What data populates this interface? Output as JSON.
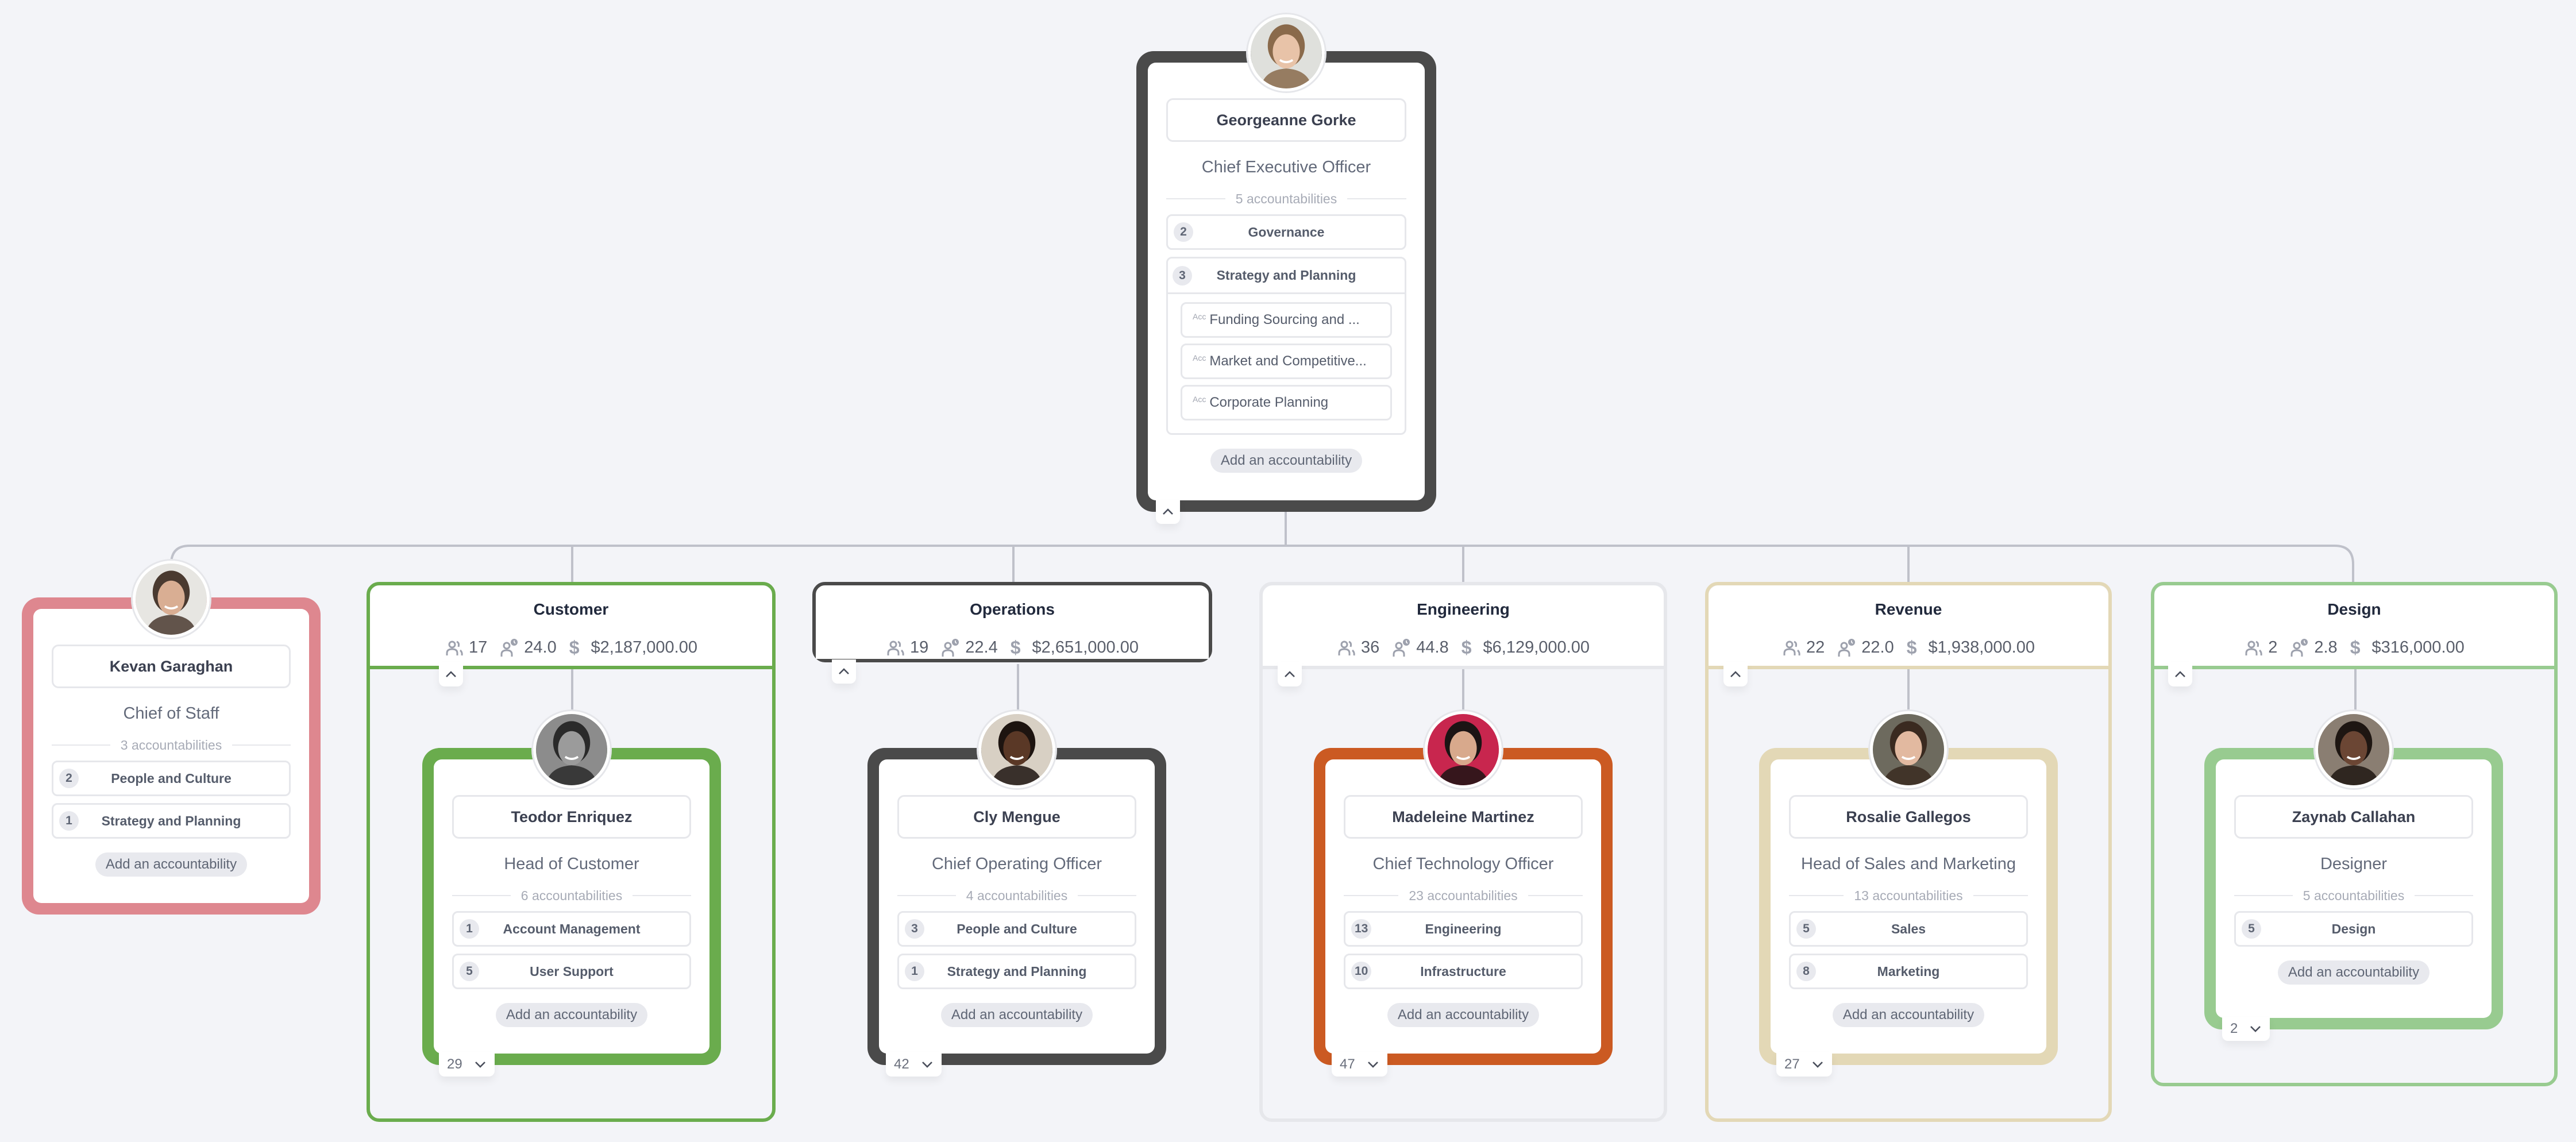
{
  "ceo": {
    "name": "Georgeanne Gorke",
    "role": "Chief Executive Officer",
    "accountabilities_label": "5 accountabilities",
    "border_color": "#4a4a4a",
    "avatar": {
      "skin": "#e8c3a8",
      "hair": "#8a6a4b",
      "bg": "#dfe0dc"
    },
    "accountabilities": [
      {
        "count": "2",
        "label": "Governance"
      }
    ],
    "expanded_group": {
      "count": "3",
      "label": "Strategy and Planning",
      "tag": "Acc",
      "items": [
        "Funding Sourcing and ...",
        "Market and Competitive...",
        "Corporate Planning"
      ]
    },
    "add_label": "Add an accountability"
  },
  "chief_of_staff": {
    "name": "Kevan Garaghan",
    "role": "Chief of Staff",
    "accountabilities_label": "3 accountabilities",
    "border_color": "#de878f",
    "avatar": {
      "skin": "#d9ae93",
      "hair": "#4a3a30",
      "bg": "#e7e6e2"
    },
    "accountabilities": [
      {
        "count": "2",
        "label": "People and Culture"
      },
      {
        "count": "1",
        "label": "Strategy and Planning"
      }
    ],
    "add_label": "Add an accountability"
  },
  "teams": [
    {
      "title": "Customer",
      "headcount": "17",
      "fte": "24.0",
      "budget": "$2,187,000.00",
      "color": "#6aac4d",
      "collapse_label": "^",
      "lead": {
        "name": "Teodor Enriquez",
        "role": "Head of Customer",
        "accountabilities_label": "6 accountabilities",
        "avatar": {
          "skin": "#9b9b9b",
          "hair": "#2a2a2a",
          "bg": "#8c8c8c"
        },
        "accountabilities": [
          {
            "count": "1",
            "label": "Account Management"
          },
          {
            "count": "5",
            "label": "User Support"
          }
        ],
        "add_label": "Add an accountability",
        "reports_count": "29"
      }
    },
    {
      "title": "Operations",
      "headcount": "19",
      "fte": "22.4",
      "budget": "$2,651,000.00",
      "color": "#4a4a4a",
      "collapse_label": "^",
      "lead": {
        "name": "Cly Mengue",
        "role": "Chief Operating Officer",
        "accountabilities_label": "4 accountabilities",
        "avatar": {
          "skin": "#5a3826",
          "hair": "#1d1410",
          "bg": "#d8d0c4"
        },
        "accountabilities": [
          {
            "count": "3",
            "label": "People and Culture"
          },
          {
            "count": "1",
            "label": "Strategy and Planning"
          }
        ],
        "add_label": "Add an accountability",
        "reports_count": "42"
      }
    },
    {
      "title": "Engineering",
      "headcount": "36",
      "fte": "44.8",
      "budget": "$6,129,000.00",
      "color": "#e6e7eb",
      "collapse_label": "^",
      "lead": {
        "name": "Madeleine Martinez",
        "role": "Chief Technology Officer",
        "accountabilities_label": "23 accountabilities",
        "avatar": {
          "skin": "#d8a98c",
          "hair": "#1c1414",
          "bg": "#c8264e"
        },
        "card_color": "#cb5a22",
        "accountabilities": [
          {
            "count": "13",
            "label": "Engineering"
          },
          {
            "count": "10",
            "label": "Infrastructure"
          }
        ],
        "add_label": "Add an accountability",
        "reports_count": "47"
      }
    },
    {
      "title": "Revenue",
      "headcount": "22",
      "fte": "22.0",
      "budget": "$1,938,000.00",
      "color": "#e3d8b6",
      "collapse_label": "^",
      "lead": {
        "name": "Rosalie Gallegos",
        "role": "Head of Sales and Marketing",
        "accountabilities_label": "13 accountabilities",
        "avatar": {
          "skin": "#e2b9a0",
          "hair": "#3a2a20",
          "bg": "#6d6a5e"
        },
        "accountabilities": [
          {
            "count": "5",
            "label": "Sales"
          },
          {
            "count": "8",
            "label": "Marketing"
          }
        ],
        "add_label": "Add an accountability",
        "reports_count": "27"
      }
    },
    {
      "title": "Design",
      "headcount": "2",
      "fte": "2.8",
      "budget": "$316,000.00",
      "color": "#98cb90",
      "collapse_label": "^",
      "lead": {
        "name": "Zaynab Callahan",
        "role": "Designer",
        "accountabilities_label": "5 accountabilities",
        "avatar": {
          "skin": "#6b4634",
          "hair": "#1e1612",
          "bg": "#8a7e72"
        },
        "accountabilities": [
          {
            "count": "5",
            "label": "Design"
          }
        ],
        "add_label": "Add an accountability",
        "reports_count": "2"
      }
    }
  ]
}
